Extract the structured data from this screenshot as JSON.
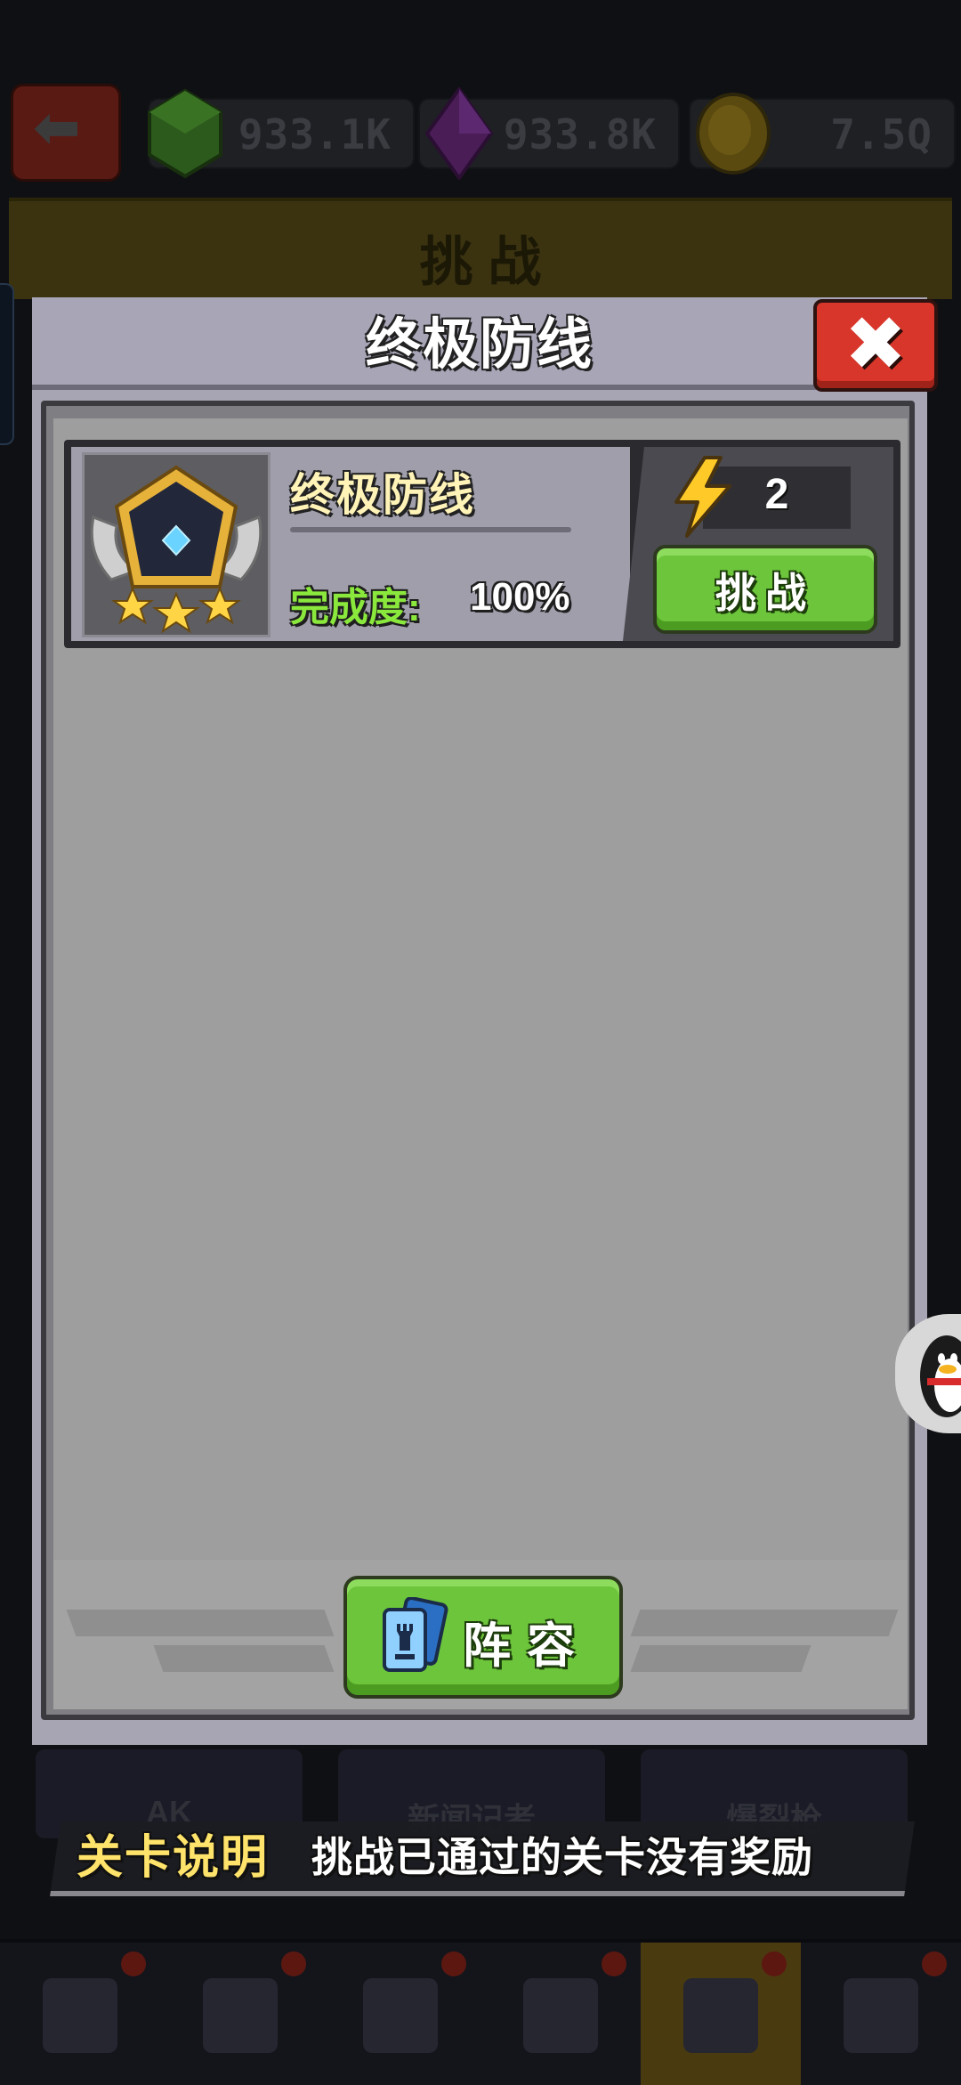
{
  "top_bar": {
    "resources": [
      {
        "name": "green-gem",
        "value": "933.1K",
        "color": "#2c5a1c"
      },
      {
        "name": "purple-crystal",
        "value": "933.8K",
        "color": "#4a1d57"
      },
      {
        "name": "gold-coin",
        "value": "7.5Q",
        "color": "#5a4a10"
      }
    ]
  },
  "background": {
    "section_title": "挑 战",
    "cards": [
      "AK",
      "新闻记者",
      "爆裂枪"
    ],
    "nav_items": [
      "trophy-icon",
      "team-icon",
      "pistol-icon",
      "book-icon",
      "swords-icon",
      "shop-icon"
    ]
  },
  "modal": {
    "title": "终极防线",
    "close_symbol": "✖",
    "level": {
      "name": "终极防线",
      "progress_label": "完成度:",
      "progress_value": "100%",
      "stars": 3,
      "energy_cost": "2",
      "challenge_label": "挑战"
    },
    "lineup_label": "阵容"
  },
  "tip": {
    "title": "关卡说明",
    "text": "挑战已通过的关卡没有奖励"
  },
  "colors": {
    "accent_green": "#6cc53a",
    "close_red": "#d9362b",
    "gold": "#ffe36a",
    "progress_green": "#8ae83d"
  }
}
